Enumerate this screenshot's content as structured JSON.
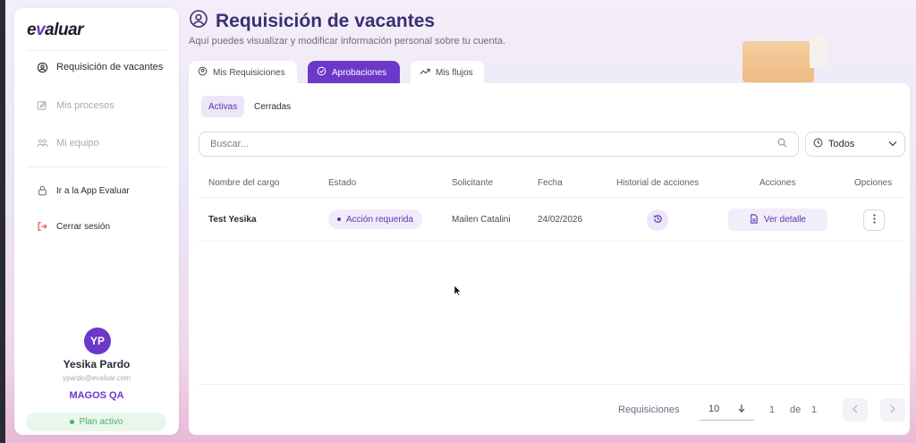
{
  "brand": {
    "logo_pre": "e",
    "logo_v": "v",
    "logo_post": "aluar"
  },
  "sidebar": {
    "items": [
      {
        "label": "Requisición de vacantes",
        "icon": "requisition-icon"
      },
      {
        "label": "Mis procesos",
        "icon": "edit-icon"
      },
      {
        "label": "Mi equipo",
        "icon": "team-icon"
      },
      {
        "label": "Ir a la App Evaluar",
        "icon": "lock-icon"
      },
      {
        "label": "Cerrar sesión",
        "icon": "logout-icon"
      }
    ],
    "user": {
      "initials": "YP",
      "name": "Yesika Pardo",
      "email": "ypardo@evaluar.com",
      "org": "MAGOS QA",
      "plan": "Plan activo"
    }
  },
  "header": {
    "title": "Requisición de vacantes",
    "subtitle": "Aquí puedes visualizar y modificar información personal sobre tu cuenta."
  },
  "tabs": [
    {
      "label": "Mis Requisiciones"
    },
    {
      "label": "Aprobaciones"
    },
    {
      "label": "Mis flujos"
    }
  ],
  "subtabs": [
    {
      "label": "Activas"
    },
    {
      "label": "Cerradas"
    }
  ],
  "search": {
    "placeholder": "Buscar..."
  },
  "filter": {
    "value": "Todos"
  },
  "table": {
    "headers": [
      "Nombre del cargo",
      "Estado",
      "Solicitante",
      "Fecha",
      "Historial de acciones",
      "Acciones",
      "Opciones"
    ],
    "rows": [
      {
        "cargo": "Test Yesika",
        "estado": "Acción requerida",
        "solicitante": "Mailen Catalini",
        "fecha": "24/02/2026",
        "accion": "Ver detalle"
      }
    ]
  },
  "pagination": {
    "label": "Requisiciones",
    "page_size": "10",
    "current": "1",
    "of": "de",
    "total": "1"
  },
  "colors": {
    "accent": "#6b38c9",
    "accent_soft": "#ece6f8",
    "success": "#4caf6a"
  }
}
